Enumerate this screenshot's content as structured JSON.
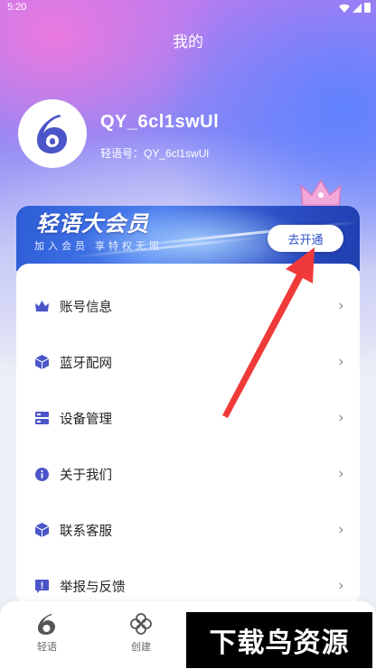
{
  "status_bar": {
    "time": "5:20"
  },
  "page": {
    "title": "我的"
  },
  "profile": {
    "username": "QY_6cl1swUl",
    "id_label": "轻语号：",
    "id_value": "QY_6cl1swUl"
  },
  "vip": {
    "title": "轻语大会员",
    "subtitle": "加入会员 享特权无限",
    "button_label": "去开通"
  },
  "menu": {
    "items": [
      {
        "label": "账号信息",
        "icon": "crown-icon"
      },
      {
        "label": "蓝牙配网",
        "icon": "cube-icon"
      },
      {
        "label": "设备管理",
        "icon": "server-icon"
      },
      {
        "label": "关于我们",
        "icon": "info-icon"
      },
      {
        "label": "联系客服",
        "icon": "box-icon"
      },
      {
        "label": "举报与反馈",
        "icon": "report-icon"
      }
    ],
    "chevron": "›"
  },
  "tabbar": {
    "tabs": [
      {
        "label": "轻语",
        "icon": "app-logo-icon"
      },
      {
        "label": "创建",
        "icon": "flower-icon"
      }
    ]
  },
  "watermark": {
    "text": "下载鸟资源"
  },
  "colors": {
    "accent": "#4a55c9",
    "vip_button_text": "#2b4fc7",
    "arrow": "#f03a3a"
  }
}
